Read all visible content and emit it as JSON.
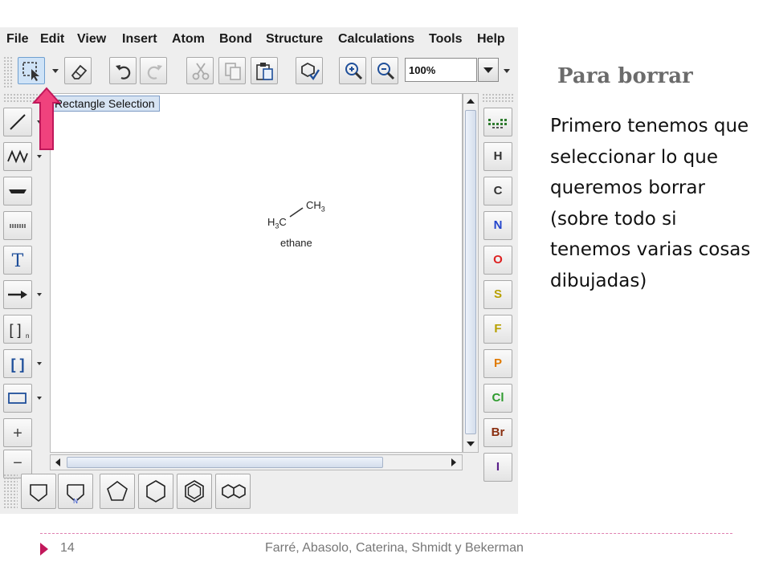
{
  "menu": [
    "File",
    "Edit",
    "View",
    "Insert",
    "Atom",
    "Bond",
    "Structure",
    "Calculations",
    "Tools",
    "Help"
  ],
  "toolbar": {
    "zoom_value": "100%",
    "icons": [
      "rectangle-selection-icon",
      "eraser-icon",
      "undo-icon",
      "redo-icon",
      "cut-icon",
      "copy-icon",
      "paste-icon",
      "clean-structure-icon",
      "zoom-in-icon",
      "zoom-out-icon"
    ]
  },
  "tooltip": "Rectangle Selection",
  "molecule": {
    "left_label": "H",
    "left_sub": "3",
    "left_tail": "C",
    "right_label": "CH",
    "right_sub": "3",
    "name": "ethane"
  },
  "elements": [
    "H",
    "C",
    "N",
    "O",
    "S",
    "F",
    "P",
    "Cl",
    "Br",
    "I"
  ],
  "element_colors": {
    "H": "#333333",
    "C": "#333333",
    "N": "#2244cc",
    "O": "#dd2222",
    "S": "#b8a000",
    "F": "#b8a000",
    "P": "#e07a00",
    "Cl": "#2e9b2e",
    "Br": "#8a2f10",
    "I": "#5a1f8a"
  },
  "left_tools": [
    "single-bond-icon",
    "chain-icon",
    "bold-bond-icon",
    "dashed-bond-icon",
    "text-tool-icon",
    "reaction-arrow-icon",
    "sgroup-bracket-icon",
    "bracket-icon",
    "rectangle-shape-icon",
    "increase-charge-icon",
    "decrease-charge-icon"
  ],
  "left_tool_labels": {
    "increase": "+",
    "decrease": "−",
    "text": "T",
    "bracket": "[ ]",
    "sgroup": "[ ]",
    "sgroup_sub": "n"
  },
  "templates": [
    "cyclopentane-template-icon",
    "pyrrolidine-template-icon",
    "pentagon-template-icon",
    "hexagon-template-icon",
    "benzene-template-icon",
    "naphthalene-template-icon"
  ],
  "template_label_n": "N",
  "slide": {
    "title": "Para borrar",
    "body": "Primero tenemos que seleccionar lo que queremos borrar (sobre todo si tenemos varias cosas dibujadas)",
    "page": "14",
    "authors": "Farré, Abasolo, Caterina, Shmidt y Bekerman"
  },
  "colors": {
    "accent_pink": "#f0427d",
    "selection_blue": "#cfe3f7",
    "footer_triangle": "#c2185b"
  }
}
